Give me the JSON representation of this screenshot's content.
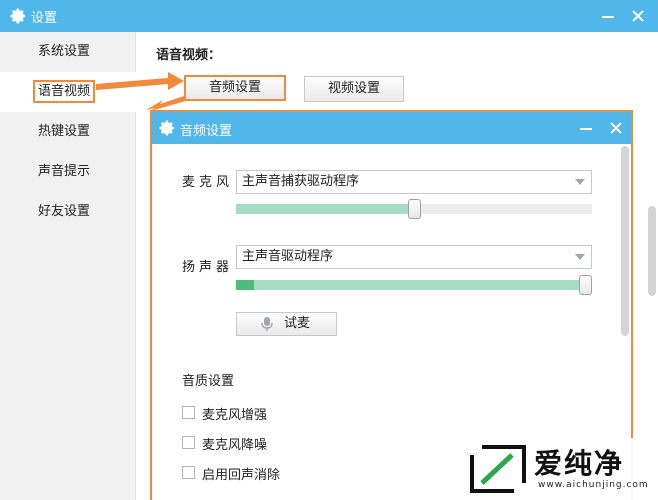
{
  "window": {
    "title": "设置",
    "icon": "gear-icon"
  },
  "sidebar": {
    "items": [
      {
        "label": "系统设置",
        "active": false
      },
      {
        "label": "语音视频",
        "active": true
      },
      {
        "label": "热键设置",
        "active": false
      },
      {
        "label": "声音提示",
        "active": false
      },
      {
        "label": "好友设置",
        "active": false
      }
    ]
  },
  "main": {
    "section_title": "语音视频：",
    "audio_button": "音频设置",
    "video_button": "视频设置"
  },
  "dialog": {
    "title": "音频设置",
    "microphone": {
      "label": "麦克风",
      "device": "主声音捕获驱动程序",
      "volume": 0.5
    },
    "speaker": {
      "label": "扬声器",
      "device": "主声音驱动程序",
      "volume": 1.0,
      "level": 0.05
    },
    "test_button": "试麦",
    "quality_title": "音质设置",
    "options": [
      {
        "label": "麦克风增强",
        "checked": false
      },
      {
        "label": "麦克风降噪",
        "checked": false
      },
      {
        "label": "启用回声消除",
        "checked": false
      }
    ]
  },
  "watermark": {
    "title": "爱纯净",
    "url": "www.aichunjing.com"
  },
  "colors": {
    "titlebar": "#4fb7ea",
    "highlight": "#f08a3c",
    "meter": "#a6dcc1",
    "meter_strong": "#4cbd7a"
  }
}
